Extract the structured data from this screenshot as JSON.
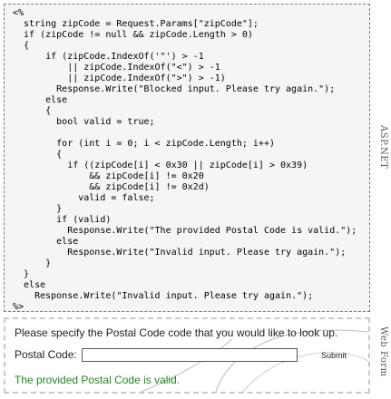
{
  "code_panel": {
    "side_label": "ASP.NET",
    "lines": [
      "<%",
      "  string zipCode = Request.Params[\"zipCode\"];",
      "  if (zipCode != null && zipCode.Length > 0)",
      "  {",
      "      if (zipCode.IndexOf('\"') > -1",
      "          || zipCode.IndexOf(\"<\") > -1",
      "          || zipCode.IndexOf(\">\") > -1)",
      "        Response.Write(\"Blocked input. Please try again.\");",
      "      else",
      "      {",
      "        bool valid = true;",
      "",
      "        for (int i = 0; i < zipCode.Length; i++)",
      "        {",
      "          if ((zipCode[i] < 0x30 || zipCode[i] > 0x39)",
      "              && zipCode[i] != 0x20",
      "              && zipCode[i] != 0x2d)",
      "            valid = false;",
      "        }",
      "        if (valid)",
      "          Response.Write(\"The provided Postal Code is valid.\");",
      "        else",
      "          Response.Write(\"Invalid input. Please try again.\");",
      "      }",
      "  }",
      "  else",
      "    Response.Write(\"Invalid input. Please try again.\");",
      "%>"
    ]
  },
  "web_form": {
    "side_label": "Web Form",
    "prompt": "Please specify the Postal Code code that you would like to look up.",
    "postal_label": "Postal Code:",
    "postal_value": "",
    "submit_label": "Submit",
    "result_text": "The provided Postal Code is valid.",
    "result_color": "#1e8a1e"
  }
}
